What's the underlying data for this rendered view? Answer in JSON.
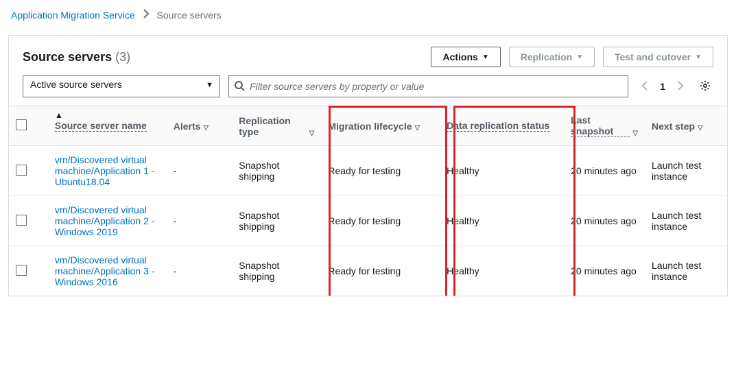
{
  "breadcrumb": {
    "root": "Application Migration Service",
    "current": "Source servers"
  },
  "header": {
    "title": "Source servers",
    "count": "(3)"
  },
  "buttons": {
    "actions": "Actions",
    "replication": "Replication",
    "test_cutover": "Test and cutover"
  },
  "filter": {
    "selected": "Active source servers",
    "search_placeholder": "Filter source servers by property or value"
  },
  "pager": {
    "page": "1"
  },
  "columns": {
    "name": "Source server name",
    "alerts": "Alerts",
    "rep_type": "Replication type",
    "lifecycle": "Migration lifecycle",
    "data_status": "Data replication status",
    "snapshot": "Last snapshot",
    "next": "Next step"
  },
  "rows": [
    {
      "name": "vm/Discovered virtual machine/Application 1 - Ubuntu18.04",
      "alerts": "-",
      "rep_type": "Snapshot shipping",
      "lifecycle": "Ready for testing",
      "data_status": "Healthy",
      "snapshot": "20 minutes ago",
      "next": "Launch test instance"
    },
    {
      "name": "vm/Discovered virtual machine/Application 2 - Windows 2019",
      "alerts": "-",
      "rep_type": "Snapshot shipping",
      "lifecycle": "Ready for testing",
      "data_status": "Healthy",
      "snapshot": "20 minutes ago",
      "next": "Launch test instance"
    },
    {
      "name": "vm/Discovered virtual machine/Application 3 - Windows 2016",
      "alerts": "-",
      "rep_type": "Snapshot shipping",
      "lifecycle": "Ready for testing",
      "data_status": "Healthy",
      "snapshot": "20 minutes ago",
      "next": "Launch test instance"
    }
  ]
}
